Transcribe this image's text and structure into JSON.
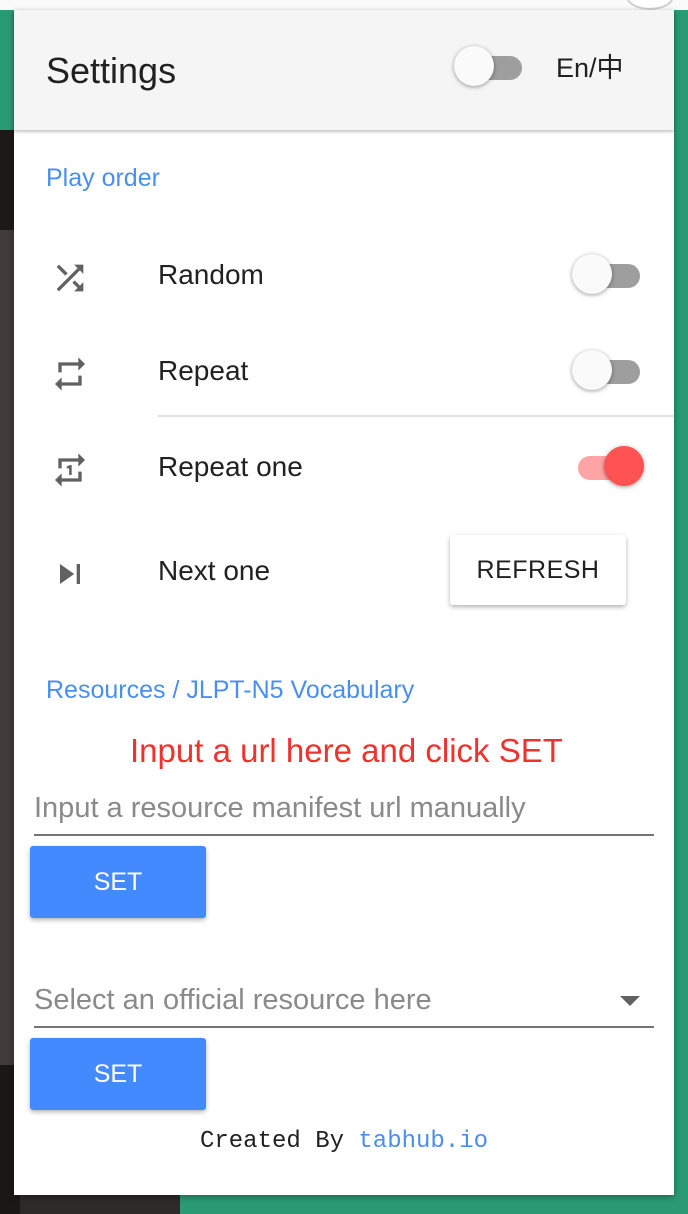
{
  "header": {
    "title": "Settings",
    "lang_toggle_label": "En/中",
    "lang_toggle_on": false
  },
  "play_order": {
    "section_title": "Play order",
    "items": [
      {
        "label": "Random",
        "icon": "shuffle-icon",
        "enabled": false
      },
      {
        "label": "Repeat",
        "icon": "repeat-icon",
        "enabled": false
      },
      {
        "label": "Repeat one",
        "icon": "repeat-one-icon",
        "enabled": true
      },
      {
        "label": "Next one",
        "icon": "skip-next-icon",
        "action_label": "REFRESH"
      }
    ]
  },
  "resources": {
    "section_title": "Resources / JLPT-N5 Vocabulary",
    "hint": "Input a url here and click SET",
    "url_input": {
      "placeholder": "Input a resource manifest url manually",
      "value": ""
    },
    "url_set_label": "SET",
    "official_select": {
      "placeholder": "Select an official resource here"
    },
    "official_set_label": "SET"
  },
  "footer": {
    "prefix": "Created By ",
    "link_text": "tabhub.io"
  },
  "colors": {
    "accent_blue": "#448aff",
    "section_blue": "#4a8ff0",
    "switch_on": "#ff5252",
    "hint_red": "#f0322e",
    "background_green": "#2a9a74"
  }
}
